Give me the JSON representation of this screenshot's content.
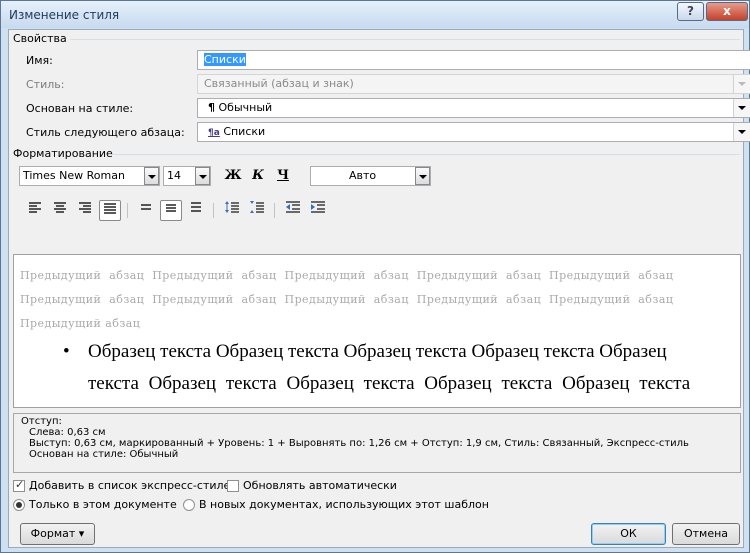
{
  "window": {
    "title": "Изменение стиля",
    "help_glyph": "?",
    "close_glyph": "x"
  },
  "properties": {
    "group_label": "Свойства",
    "name": {
      "label": "Имя:",
      "value": "Списки"
    },
    "style_type": {
      "label": "Стиль:",
      "value": "Связанный (абзац и знак)"
    },
    "based_on": {
      "label": "Основан на стиле:",
      "icon_glyph": "¶",
      "value": "Обычный"
    },
    "next_style": {
      "label": "Стиль следующего абзаца:",
      "icon_glyph": "¶a",
      "value": "Списки"
    }
  },
  "formatting": {
    "group_label": "Форматирование",
    "font": "Times New Roman",
    "size": "14",
    "bold": "Ж",
    "italic": "К",
    "underline": "Ч",
    "color": "Авто",
    "align_left_glyph": "≡",
    "active_alignment": "justify",
    "icons": [
      "align-left-icon",
      "align-center-icon",
      "align-right-icon",
      "align-justify-icon",
      "line-spacing-single-icon",
      "line-spacing-1-5-icon",
      "line-spacing-double-icon",
      "space-before-increase-icon",
      "space-before-decrease-icon",
      "indent-decrease-icon",
      "indent-increase-icon"
    ]
  },
  "preview": {
    "prev_line1": "Предыдущий абзац Предыдущий абзац Предыдущий абзац Предыдущий абзац Предыдущий абзац",
    "prev_line2": "Предыдущий абзац Предыдущий абзац Предыдущий абзац Предыдущий абзац Предыдущий абзац",
    "prev_line3": "Предыдущий абзац",
    "bullet": "•",
    "sample_line1": "Образец текста Образец текста Образец текста Образец текста Образец",
    "sample_line2": "текста Образец текста Образец текста Образец текста Образец текста"
  },
  "description": {
    "line1": "Отступ:",
    "line2": "Слева:  0,63 см",
    "line3": "Выступ:  0,63 см, маркированный + Уровень: 1 + Выровнять по:  1,26 см + Отступ:  1,9 см, Стиль: Связанный, Экспресс-стиль",
    "line4": "Основан на стиле: Обычный"
  },
  "options": {
    "add_to_quick": {
      "label": "Добавить в список экспресс-стилей",
      "checked": true
    },
    "auto_update": {
      "label": "Обновлять автоматически",
      "checked": false
    },
    "only_this_doc": {
      "label": "Только в этом документе",
      "selected": true
    },
    "new_docs": {
      "label": "В новых документах, использующих этот шаблон",
      "selected": false
    }
  },
  "buttons": {
    "format": "Формат",
    "format_arrow": "▾",
    "ok": "ОК",
    "cancel": "Отмена"
  }
}
